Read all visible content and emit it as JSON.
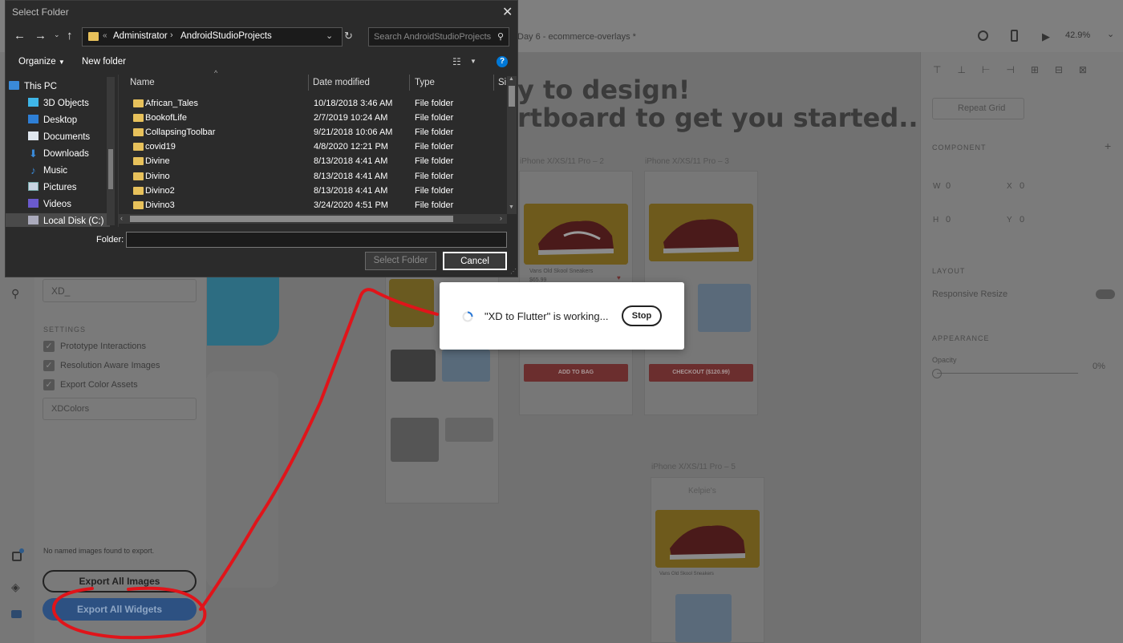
{
  "xd": {
    "doc_title": "Day 6 - ecommerce-overlays *",
    "zoom": "42.9%",
    "hero_line1": "y to design!",
    "hero_line2": "rtboard to get you started...",
    "artboards": {
      "a2": "iPhone X/XS/11 Pro – 2",
      "a3": "iPhone X/XS/11 Pro – 3",
      "a5": "iPhone X/XS/11 Pro – 5"
    },
    "product": {
      "name": "Vans Old Skool Sneakers",
      "price": "$65.99",
      "add_to_bag": "ADD TO BAG",
      "checkout": "CHECKOUT ($120.99)",
      "brand": "Kelpie's"
    },
    "right_panel": {
      "repeat_grid": "Repeat Grid",
      "component": "COMPONENT",
      "w_label": "W",
      "w_val": "0",
      "x_label": "X",
      "x_val": "0",
      "h_label": "H",
      "h_val": "0",
      "y_label": "Y",
      "y_val": "0",
      "layout": "LAYOUT",
      "responsive": "Responsive Resize",
      "appearance": "APPEARANCE",
      "opacity": "Opacity",
      "opacity_val": "0%"
    },
    "plugin": {
      "xd_field": "XD_",
      "settings": "SETTINGS",
      "prototype": "Prototype Interactions",
      "resolution": "Resolution Aware Images",
      "export_colors": "Export Color Assets",
      "xdcolors": "XDColors",
      "no_images": "No named images found to export.",
      "export_images": "Export All Images",
      "export_widgets": "Export All Widgets"
    }
  },
  "dialog": {
    "title": "Select Folder",
    "breadcrumb": [
      "Administrator",
      "AndroidStudioProjects"
    ],
    "search_placeholder": "Search AndroidStudioProjects",
    "organize": "Organize",
    "new_folder": "New folder",
    "tree": [
      "This PC",
      "3D Objects",
      "Desktop",
      "Documents",
      "Downloads",
      "Music",
      "Pictures",
      "Videos",
      "Local Disk (C:)"
    ],
    "columns": {
      "name": "Name",
      "date": "Date modified",
      "type": "Type",
      "size": "Si"
    },
    "files": [
      {
        "name": "African_Tales",
        "date": "10/18/2018 3:46 AM",
        "type": "File folder"
      },
      {
        "name": "BookofLife",
        "date": "2/7/2019 10:24 AM",
        "type": "File folder"
      },
      {
        "name": "CollapsingToolbar",
        "date": "9/21/2018 10:06 AM",
        "type": "File folder"
      },
      {
        "name": "covid19",
        "date": "4/8/2020 12:21 PM",
        "type": "File folder"
      },
      {
        "name": "Divine",
        "date": "8/13/2018 4:41 AM",
        "type": "File folder"
      },
      {
        "name": "Divino",
        "date": "8/13/2018 4:41 AM",
        "type": "File folder"
      },
      {
        "name": "Divino2",
        "date": "8/13/2018 4:41 AM",
        "type": "File folder"
      },
      {
        "name": "Divino3",
        "date": "3/24/2020 4:51 PM",
        "type": "File folder"
      }
    ],
    "folder_label": "Folder:",
    "folder_value": "",
    "select_btn": "Select Folder",
    "cancel_btn": "Cancel"
  },
  "progress": {
    "message": "\"XD to Flutter\" is working...",
    "stop": "Stop"
  },
  "colors": {
    "annotation": "#e0141a",
    "dialog_bg": "#2b2b2b",
    "folder": "#e7c15b",
    "accent": "#0078d7"
  }
}
